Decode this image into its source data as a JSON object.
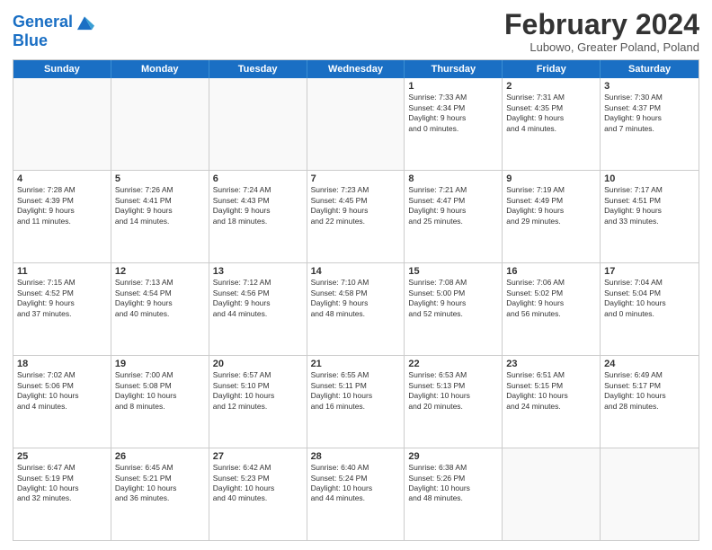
{
  "header": {
    "logo_line1": "General",
    "logo_line2": "Blue",
    "month": "February 2024",
    "location": "Lubowo, Greater Poland, Poland"
  },
  "days_of_week": [
    "Sunday",
    "Monday",
    "Tuesday",
    "Wednesday",
    "Thursday",
    "Friday",
    "Saturday"
  ],
  "weeks": [
    [
      {
        "day": "",
        "info": ""
      },
      {
        "day": "",
        "info": ""
      },
      {
        "day": "",
        "info": ""
      },
      {
        "day": "",
        "info": ""
      },
      {
        "day": "1",
        "info": "Sunrise: 7:33 AM\nSunset: 4:34 PM\nDaylight: 9 hours\nand 0 minutes."
      },
      {
        "day": "2",
        "info": "Sunrise: 7:31 AM\nSunset: 4:35 PM\nDaylight: 9 hours\nand 4 minutes."
      },
      {
        "day": "3",
        "info": "Sunrise: 7:30 AM\nSunset: 4:37 PM\nDaylight: 9 hours\nand 7 minutes."
      }
    ],
    [
      {
        "day": "4",
        "info": "Sunrise: 7:28 AM\nSunset: 4:39 PM\nDaylight: 9 hours\nand 11 minutes."
      },
      {
        "day": "5",
        "info": "Sunrise: 7:26 AM\nSunset: 4:41 PM\nDaylight: 9 hours\nand 14 minutes."
      },
      {
        "day": "6",
        "info": "Sunrise: 7:24 AM\nSunset: 4:43 PM\nDaylight: 9 hours\nand 18 minutes."
      },
      {
        "day": "7",
        "info": "Sunrise: 7:23 AM\nSunset: 4:45 PM\nDaylight: 9 hours\nand 22 minutes."
      },
      {
        "day": "8",
        "info": "Sunrise: 7:21 AM\nSunset: 4:47 PM\nDaylight: 9 hours\nand 25 minutes."
      },
      {
        "day": "9",
        "info": "Sunrise: 7:19 AM\nSunset: 4:49 PM\nDaylight: 9 hours\nand 29 minutes."
      },
      {
        "day": "10",
        "info": "Sunrise: 7:17 AM\nSunset: 4:51 PM\nDaylight: 9 hours\nand 33 minutes."
      }
    ],
    [
      {
        "day": "11",
        "info": "Sunrise: 7:15 AM\nSunset: 4:52 PM\nDaylight: 9 hours\nand 37 minutes."
      },
      {
        "day": "12",
        "info": "Sunrise: 7:13 AM\nSunset: 4:54 PM\nDaylight: 9 hours\nand 40 minutes."
      },
      {
        "day": "13",
        "info": "Sunrise: 7:12 AM\nSunset: 4:56 PM\nDaylight: 9 hours\nand 44 minutes."
      },
      {
        "day": "14",
        "info": "Sunrise: 7:10 AM\nSunset: 4:58 PM\nDaylight: 9 hours\nand 48 minutes."
      },
      {
        "day": "15",
        "info": "Sunrise: 7:08 AM\nSunset: 5:00 PM\nDaylight: 9 hours\nand 52 minutes."
      },
      {
        "day": "16",
        "info": "Sunrise: 7:06 AM\nSunset: 5:02 PM\nDaylight: 9 hours\nand 56 minutes."
      },
      {
        "day": "17",
        "info": "Sunrise: 7:04 AM\nSunset: 5:04 PM\nDaylight: 10 hours\nand 0 minutes."
      }
    ],
    [
      {
        "day": "18",
        "info": "Sunrise: 7:02 AM\nSunset: 5:06 PM\nDaylight: 10 hours\nand 4 minutes."
      },
      {
        "day": "19",
        "info": "Sunrise: 7:00 AM\nSunset: 5:08 PM\nDaylight: 10 hours\nand 8 minutes."
      },
      {
        "day": "20",
        "info": "Sunrise: 6:57 AM\nSunset: 5:10 PM\nDaylight: 10 hours\nand 12 minutes."
      },
      {
        "day": "21",
        "info": "Sunrise: 6:55 AM\nSunset: 5:11 PM\nDaylight: 10 hours\nand 16 minutes."
      },
      {
        "day": "22",
        "info": "Sunrise: 6:53 AM\nSunset: 5:13 PM\nDaylight: 10 hours\nand 20 minutes."
      },
      {
        "day": "23",
        "info": "Sunrise: 6:51 AM\nSunset: 5:15 PM\nDaylight: 10 hours\nand 24 minutes."
      },
      {
        "day": "24",
        "info": "Sunrise: 6:49 AM\nSunset: 5:17 PM\nDaylight: 10 hours\nand 28 minutes."
      }
    ],
    [
      {
        "day": "25",
        "info": "Sunrise: 6:47 AM\nSunset: 5:19 PM\nDaylight: 10 hours\nand 32 minutes."
      },
      {
        "day": "26",
        "info": "Sunrise: 6:45 AM\nSunset: 5:21 PM\nDaylight: 10 hours\nand 36 minutes."
      },
      {
        "day": "27",
        "info": "Sunrise: 6:42 AM\nSunset: 5:23 PM\nDaylight: 10 hours\nand 40 minutes."
      },
      {
        "day": "28",
        "info": "Sunrise: 6:40 AM\nSunset: 5:24 PM\nDaylight: 10 hours\nand 44 minutes."
      },
      {
        "day": "29",
        "info": "Sunrise: 6:38 AM\nSunset: 5:26 PM\nDaylight: 10 hours\nand 48 minutes."
      },
      {
        "day": "",
        "info": ""
      },
      {
        "day": "",
        "info": ""
      }
    ]
  ]
}
